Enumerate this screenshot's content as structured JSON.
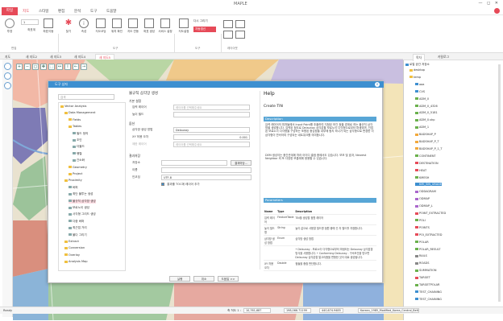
{
  "app": {
    "title": "MAPLE",
    "window_controls": "— ◻ ✕"
  },
  "menu": {
    "file": "파일",
    "items": [
      "지도",
      "스타일",
      "편집",
      "분석",
      "도구",
      "도움말"
    ]
  },
  "ribbon": {
    "buttons": [
      "투영",
      "좌표계",
      "좌표이동",
      "찾기",
      "속성",
      "지오코딩",
      "위치 확인",
      "지도 연동",
      "좌표 생성",
      "서비스 설정",
      "지도설정",
      "다시 그리기",
      "자동갱신",
      "레이아웃"
    ],
    "groups": [
      "편집",
      "도구",
      "도구",
      "레이아웃"
    ],
    "dropdown": "1"
  },
  "doc_tabs": {
    "left_label": "지도",
    "tabs": [
      "새 지도2",
      "새 지도3",
      "새 지도4",
      "새 지도5"
    ]
  },
  "dialog": {
    "title": "도구 상자",
    "search_placeholder": "검색",
    "tree": [
      {
        "label": "Vector Analysis",
        "level": 0
      },
      {
        "label": "Data Management",
        "level": 1
      },
      {
        "label": "Fields",
        "level": 2
      },
      {
        "label": "Tables",
        "level": 2
      },
      {
        "label": "필드 정의",
        "level": 3
      },
      {
        "label": "조인",
        "level": 3
      },
      {
        "label": "더블드",
        "level": 3
      },
      {
        "label": "행렬",
        "level": 3
      },
      {
        "label": "간소화",
        "level": 3
      },
      {
        "label": "Geometry",
        "level": 2
      },
      {
        "label": "Project",
        "level": 2
      },
      {
        "label": "Proximity",
        "level": 1
      },
      {
        "label": "버퍼",
        "level": 2
      },
      {
        "label": "최단 불투는 생성",
        "level": 2
      },
      {
        "label": "불규칙 삼각망 생성",
        "level": 2,
        "selected": true
      },
      {
        "label": "보로노이 생성",
        "level": 2
      },
      {
        "label": "사각형 그리드 생성",
        "level": 2
      },
      {
        "label": "다중 버퍼",
        "level": 2
      },
      {
        "label": "최근접 거리",
        "level": 2
      },
      {
        "label": "불다 그리기",
        "level": 2
      },
      {
        "label": "Extract",
        "level": 1
      },
      {
        "label": "Conversion",
        "level": 1
      },
      {
        "label": "Overlay",
        "level": 1
      },
      {
        "label": "Analysis Map",
        "level": 1
      }
    ],
    "form": {
      "heading": "불규칙 삼각망 생성",
      "sec_basic": "기본 설정",
      "input_layer_label": "입력 레이어",
      "input_layer_placeholder": "레이어를 선택해주세요",
      "height_field_label": "높이 필드",
      "sec_option": "옵션",
      "method_label": "삼각망 생성 방법",
      "method_value": "Delaunay",
      "xy_tol_label": "XY 허용 오차",
      "xy_tol_value": "0.001",
      "breakline_label": "제한 레이어",
      "breakline_placeholder": "레이어를 선택해주세요",
      "sec_output": "결과저장",
      "save_label": "저장소",
      "save_btn": "결과마당...",
      "name_label": "이름",
      "encoding_label": "인코딩",
      "encoding_value": "UTF-8",
      "add_map_label": "결과를 TOC에 레이어 추가",
      "run": "실행",
      "cancel": "취소",
      "helpbtn": "도움말 >>"
    },
    "help": {
      "title": "Help",
      "subtitle": "Create TIN",
      "desc_bar": "Description",
      "desc1": "입력 레이어의 피처들에서 Input Point를 추출하여 지정된 보간 점을 경계로 하는 불규칙 삼각망을 생성합니다. 입력된 점도로 Delaunay 삼각분할 보로노이 다각형으로부터 파생되며, 인접된 보로노이 다각형을 구성하는 포함된 중심점을 내부에 합지 하나가 되는 삼각형으로 변경한 이 삼각형이 연속하여 구성되는 네트워크를 의미합니다.",
      "desc2": "DEM 생성이는 중간관계에 따라 아이디 출점 중에서도 있습니다. 보조 및 효과, Nearest Neighbor 외 또 다양한 보통에에 응용할 수 있습니다.",
      "param_bar": "Parameters",
      "cols": [
        "Name",
        "Type",
        "Description"
      ],
      "rows": [
        [
          "입력 레이어",
          "FeatureTable",
          "TIN을 생성할 점원 레이어"
        ],
        [
          "높이 필드명",
          "String",
          "높이 값으로 사용할 필드명 점원 중에 숫 자 필드를 지정합니다."
        ],
        [
          "삼각망 생성 방법",
          "Enum",
          "삼각망 생성 방법"
        ],
        [
          "",
          "",
          "• Delaunay - 보로노이 다각형으로부터 파생되는 Delaunay 삼각분할 방식을 사용합니다. • Conforming Delaunay - 구속조건을 받으면 Delaunay 삼각분할 알고리즘을 변형한 것이 대로 생성됩니다."
        ],
        [
          "XY 허용 오차",
          "Double",
          "점들을 중첩 판단합니다."
        ]
      ]
    }
  },
  "right_panel": {
    "tabs": [
      "목차",
      "카탈로그"
    ],
    "root": "로컬 공간 저장소",
    "items": [
      {
        "label": "desktop",
        "color": "#f0c040"
      },
      {
        "label": "temp",
        "color": "#f0c040"
      },
      {
        "label": "aaa",
        "color": "#3d8fd0"
      },
      {
        "label": "CVS",
        "color": "#3d8fd0"
      },
      {
        "label": "ADM_0",
        "color": "#6ab04c"
      },
      {
        "label": "ADM_0_4326",
        "color": "#6ab04c"
      },
      {
        "label": "ADM_0_5181",
        "color": "#6ab04c"
      },
      {
        "label": "ADM_0.shp",
        "color": "#6ab04c"
      },
      {
        "label": "ADM_1",
        "color": "#6ab04c"
      },
      {
        "label": "BADSHAP_P",
        "color": "#f2a93b"
      },
      {
        "label": "BADSHAP_P_T",
        "color": "#f2a93b"
      },
      {
        "label": "BADSHAP_P_1_T",
        "color": "#f2a93b"
      },
      {
        "label": "CONTINENT",
        "color": "#6ab04c"
      },
      {
        "label": "DESTINATION",
        "color": "#e64a58"
      },
      {
        "label": "HEAT",
        "color": "#e64a58"
      },
      {
        "label": "KMESH",
        "color": "#6ab04c"
      },
      {
        "label": "KMI_SIN_GRADE",
        "color": "#3d8fd0",
        "selected": true
      },
      {
        "label": "ODDAGRAM",
        "color": "#aa66cc"
      },
      {
        "label": "ODMAP",
        "color": "#aa66cc"
      },
      {
        "label": "ODMAP_L",
        "color": "#aa66cc"
      },
      {
        "label": "POINT_EXTRACTED",
        "color": "#e64a58"
      },
      {
        "label": "POLI",
        "color": "#6ab04c"
      },
      {
        "label": "POINTS",
        "color": "#e64a58"
      },
      {
        "label": "POI_EXTRACTED",
        "color": "#e64a58"
      },
      {
        "label": "POLAR",
        "color": "#6ab04c"
      },
      {
        "label": "POLAR_RESULT",
        "color": "#6ab04c"
      },
      {
        "label": "RAILS",
        "color": "#888888"
      },
      {
        "label": "ROADS",
        "color": "#888888"
      },
      {
        "label": "SUMMATION",
        "color": "#6ab04c"
      },
      {
        "label": "TARGET",
        "color": "#e64a58"
      },
      {
        "label": "TARGETPOLAR",
        "color": "#6ab04c"
      },
      {
        "label": "TEST_CHAINING",
        "color": "#3d8fd0"
      },
      {
        "label": "TEST_CHAINING",
        "color": "#3d8fd0"
      }
    ]
  },
  "status": {
    "ready": "Ready",
    "scale_label": "축 척도 1 :",
    "scale": "10,761,687",
    "coord_x": "198,066.71199",
    "coord_y": "440,674.9485",
    "crs": "Korean_1985_Modified_Korea_Central_Belt"
  }
}
